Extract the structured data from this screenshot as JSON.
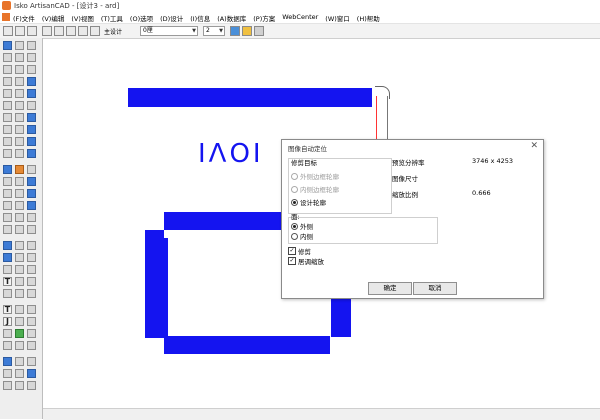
{
  "window": {
    "title": "Isko ArtisanCAD - [设计3 - ard]"
  },
  "menu": [
    "(F)文件",
    "(V)编辑",
    "(V)视图",
    "(T)工具",
    "(O)选项",
    "(D)设计",
    "(I)信息",
    "(A)数据库",
    "(P)方案",
    "WebCenter",
    "(W)窗口",
    "(H)帮助"
  ],
  "toolbar": {
    "mode_label": "主设计",
    "layer_combo": "0厘",
    "num_combo": "2"
  },
  "canvas": {
    "big_text": "IΛOI"
  },
  "dialog": {
    "title": "图像自动定位",
    "trim_group_label": "修剪目标",
    "options": [
      {
        "label": "外侧边框轮廓",
        "enabled": false,
        "selected": false
      },
      {
        "label": "内侧边框轮廓",
        "enabled": false,
        "selected": false
      },
      {
        "label": "设计轮廓",
        "enabled": true,
        "selected": true
      }
    ],
    "face_group_label": "面:",
    "face_options": [
      {
        "label": "外侧",
        "selected": true
      },
      {
        "label": "内侧",
        "selected": false
      }
    ],
    "checks": [
      {
        "label": "修剪",
        "checked": true
      },
      {
        "label": "居调缩放",
        "checked": true
      }
    ],
    "info": {
      "resolution_label": "预览分辨率",
      "resolution_value": "3746 x 4253",
      "size_label": "图像尺寸",
      "scale_label": "缩放比例",
      "scale_value": "0.666"
    },
    "ok": "确定",
    "cancel": "取消"
  },
  "colors": {
    "design_blue": "#1414f0",
    "accent_orange": "#e8742a"
  }
}
